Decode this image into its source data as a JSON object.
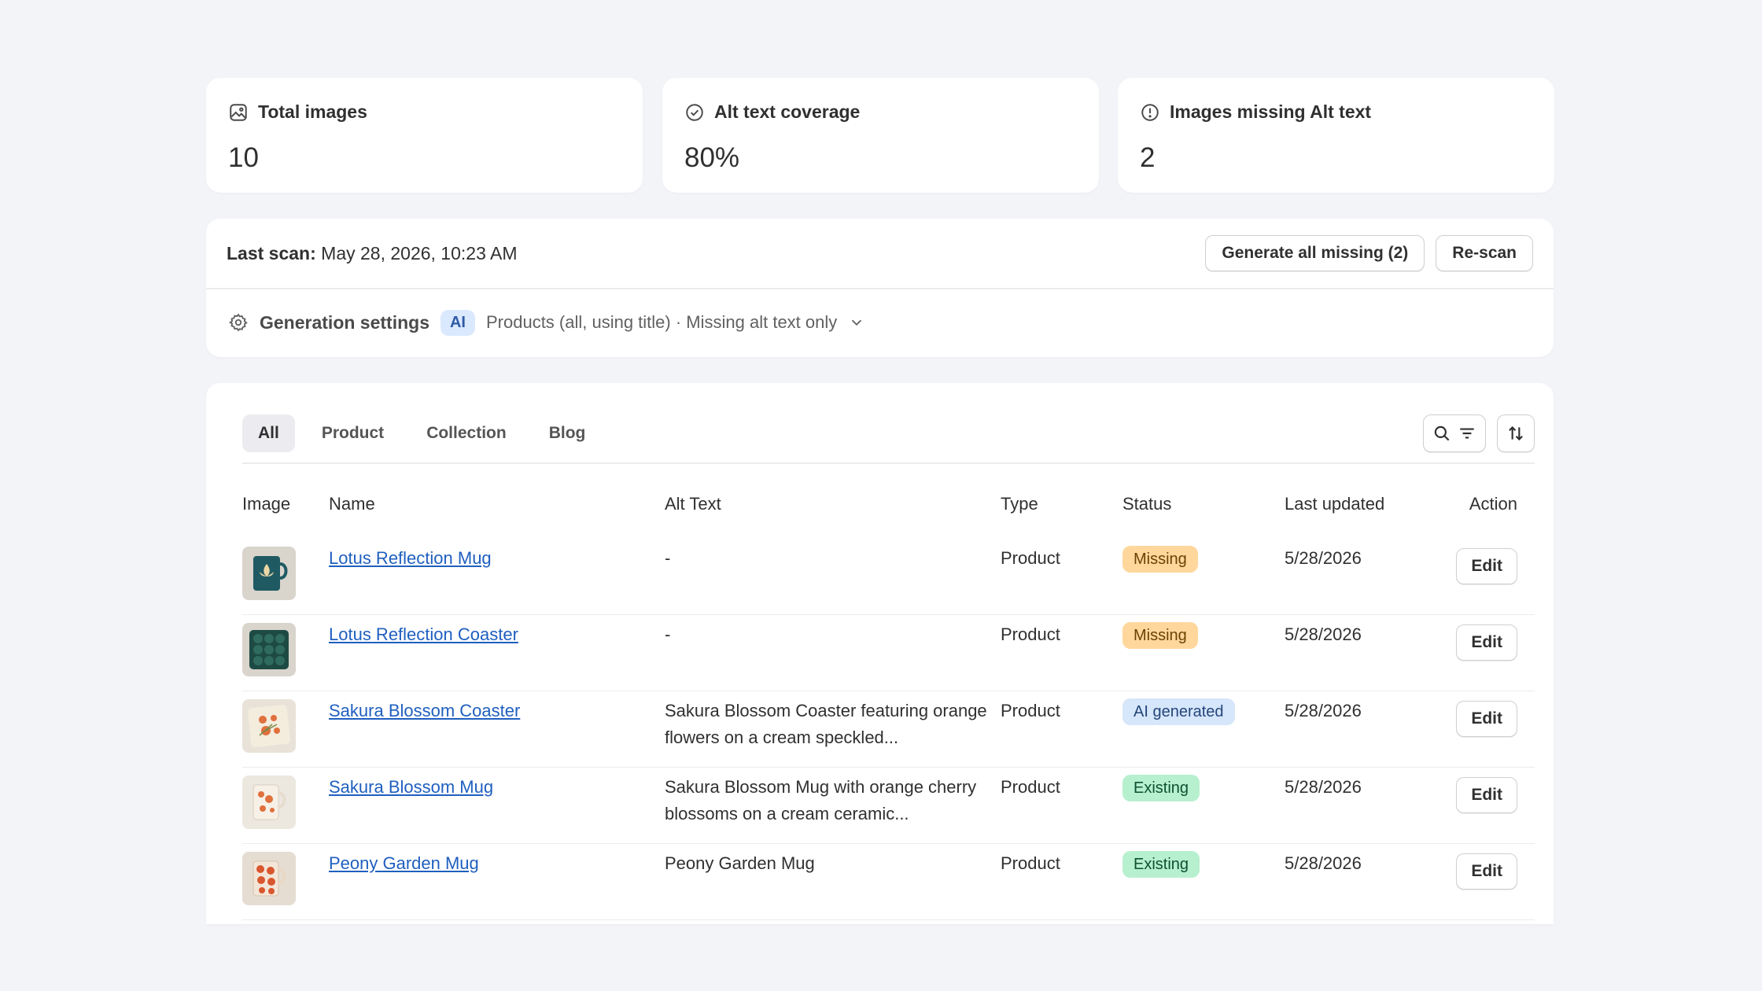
{
  "stats": [
    {
      "label": "Total images",
      "value": "10",
      "icon": "image-icon"
    },
    {
      "label": "Alt text coverage",
      "value": "80%",
      "icon": "check-circle-icon"
    },
    {
      "label": "Images missing Alt text",
      "value": "2",
      "icon": "alert-circle-icon"
    }
  ],
  "scan": {
    "label": "Last scan:",
    "date": "May 28, 2026, 10:23 AM",
    "generate_button": "Generate all missing (2)",
    "rescan_button": "Re-scan"
  },
  "settings": {
    "label": "Generation settings",
    "badge": "AI",
    "summary": "Products (all, using title) · Missing alt text only"
  },
  "tabs": [
    "All",
    "Product",
    "Collection",
    "Blog"
  ],
  "active_tab": "All",
  "columns": [
    "Image",
    "Name",
    "Alt Text",
    "Type",
    "Status",
    "Last updated",
    "Action"
  ],
  "rows": [
    {
      "name": "Lotus Reflection Mug",
      "alt": "-",
      "type": "Product",
      "status": "Missing",
      "status_kind": "missing",
      "updated": "5/28/2026",
      "action": "Edit",
      "thumb": "teal-mug"
    },
    {
      "name": "Lotus Reflection Coaster",
      "alt": "-",
      "type": "Product",
      "status": "Missing",
      "status_kind": "missing",
      "updated": "5/28/2026",
      "action": "Edit",
      "thumb": "teal-coaster"
    },
    {
      "name": "Sakura Blossom Coaster",
      "alt": "Sakura Blossom Coaster featuring orange flowers on a cream speckled...",
      "type": "Product",
      "status": "AI generated",
      "status_kind": "ai",
      "updated": "5/28/2026",
      "action": "Edit",
      "thumb": "cream-coaster"
    },
    {
      "name": "Sakura Blossom Mug",
      "alt": "Sakura Blossom Mug with orange cherry blossoms on a cream ceramic...",
      "type": "Product",
      "status": "Existing",
      "status_kind": "existing",
      "updated": "5/28/2026",
      "action": "Edit",
      "thumb": "cream-mug"
    },
    {
      "name": "Peony Garden Mug",
      "alt": "Peony Garden Mug",
      "type": "Product",
      "status": "Existing",
      "status_kind": "existing",
      "updated": "5/28/2026",
      "action": "Edit",
      "thumb": "orange-mug"
    }
  ],
  "colors": {
    "background": "#f3f4f8",
    "link": "#1f5fbf",
    "missing": "#ffd79d",
    "ai": "#d6e6fb",
    "existing": "#b7f0cf"
  }
}
